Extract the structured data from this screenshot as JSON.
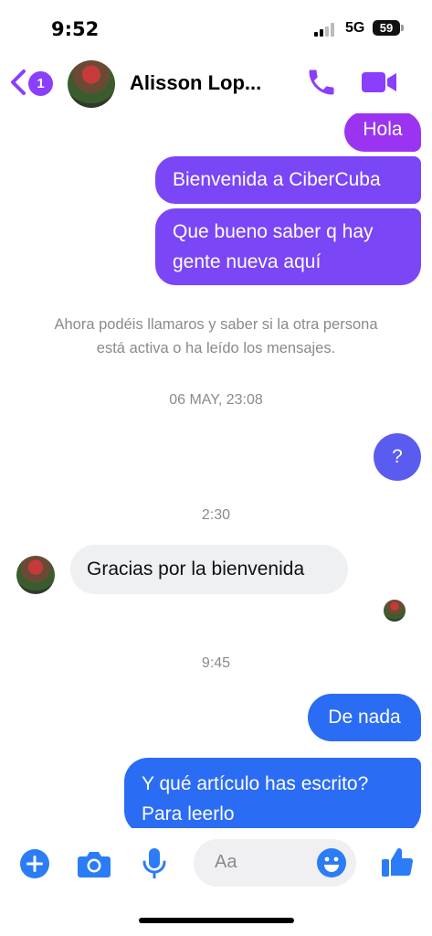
{
  "status_bar": {
    "time": "9:52",
    "network": "5G",
    "battery": "59"
  },
  "header": {
    "unread_badge": "1",
    "contact_name": "Alisson Lop...",
    "icons": [
      "back-chevron-icon",
      "avatar",
      "phone-icon",
      "video-camera-icon"
    ]
  },
  "thread": {
    "sent_1": "Hola",
    "sent_2": "Bienvenida a CiberCuba",
    "sent_3_line1": "Que bueno saber q hay",
    "sent_3_line2": "gente nueva aquí",
    "system_line1": "Ahora podéis llamaros y saber si la otra persona",
    "system_line2": "está activa o ha leído los mensajes.",
    "stamp_1": "06 MAY, 23:08",
    "sent_4": "?",
    "stamp_2": "2:30",
    "received_1": "Gracias por la bienvenida",
    "stamp_3": "9:45",
    "sent_5": "De nada",
    "sent_6_line1": "Y qué artículo has escrito?",
    "sent_6_line2": "Para leerlo"
  },
  "composer": {
    "placeholder": "Aa",
    "icons": [
      "plus-icon",
      "camera-icon",
      "microphone-icon",
      "emoji-icon",
      "thumbs-up-icon"
    ]
  },
  "colors": {
    "accent_purple": "#8a3ffc",
    "bubble_purple": "#9a34f1",
    "bubble_blue": "#2b6cf4",
    "icon_blue": "#2b7cf6"
  }
}
